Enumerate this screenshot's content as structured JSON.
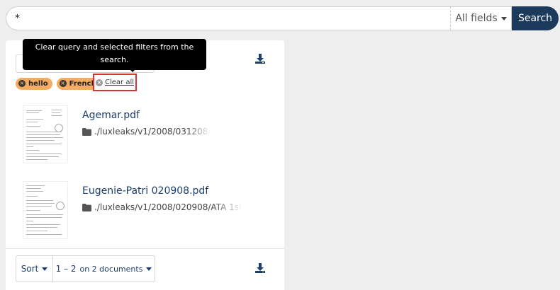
{
  "search": {
    "value": "*",
    "field_selector": "All fields",
    "button_label": "Search"
  },
  "filters": {
    "chips": [
      {
        "label": "hello"
      },
      {
        "label": "French"
      }
    ],
    "clear_all_label": "Clear all"
  },
  "tooltip": {
    "text": "Clear query and selected filters from the search."
  },
  "results": [
    {
      "title": "Agemar.pdf",
      "path": "./luxleaks/v1/2008/031208/"
    },
    {
      "title": "Eugenie-Patri 020908.pdf",
      "path": "./luxleaks/v1/2008/020908/ATA 1st"
    }
  ],
  "pagination": {
    "sort_label": "Sort",
    "range": "1 – 2",
    "total": "on 2 documents"
  },
  "colors": {
    "accent": "#1c3a5c",
    "link": "#1d3f6b",
    "chip": "#f4ab62",
    "highlight_border": "#d9322f"
  },
  "icons": {
    "download": "download-icon",
    "folder": "folder-icon",
    "close": "close-icon"
  }
}
